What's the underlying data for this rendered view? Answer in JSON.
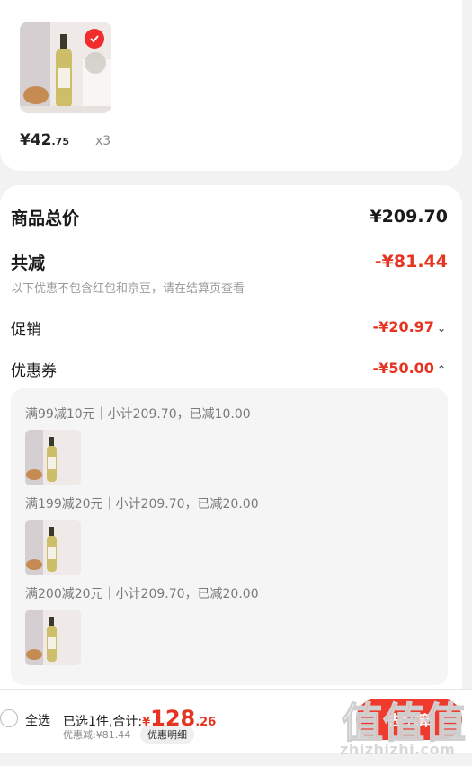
{
  "item": {
    "price_main": "¥42",
    "price_cents": ".75",
    "qty": "x3"
  },
  "summary": {
    "goods_total_label": "商品总价",
    "goods_total_value": "¥209.70",
    "reduce_label": "共减",
    "reduce_value": "-¥81.44",
    "note": "以下优惠不包含红包和京豆，请在结算页查看",
    "promo_label": "促销",
    "promo_value": "-¥20.97",
    "coupon_label": "优惠券",
    "coupon_value": "-¥50.00"
  },
  "coupons": [
    {
      "text": "满99减10元｜小计209.70，已减10.00"
    },
    {
      "text": "满199减20元｜小计209.70，已减20.00"
    },
    {
      "text": "满200减20元｜小计209.70，已减20.00"
    }
  ],
  "bottombar": {
    "select_all": "全选",
    "selected_text": "已选1件,合计:",
    "currency": "¥",
    "total_main": "128",
    "total_cents": ".26",
    "discount_text": "优惠减:¥81.44",
    "detail_label": "优惠明细",
    "checkout_label": "去结算"
  },
  "watermark": {
    "text": "zhizhizhi.com"
  },
  "colors": {
    "accent": "#e63322",
    "checkout": "#f03a2e"
  }
}
